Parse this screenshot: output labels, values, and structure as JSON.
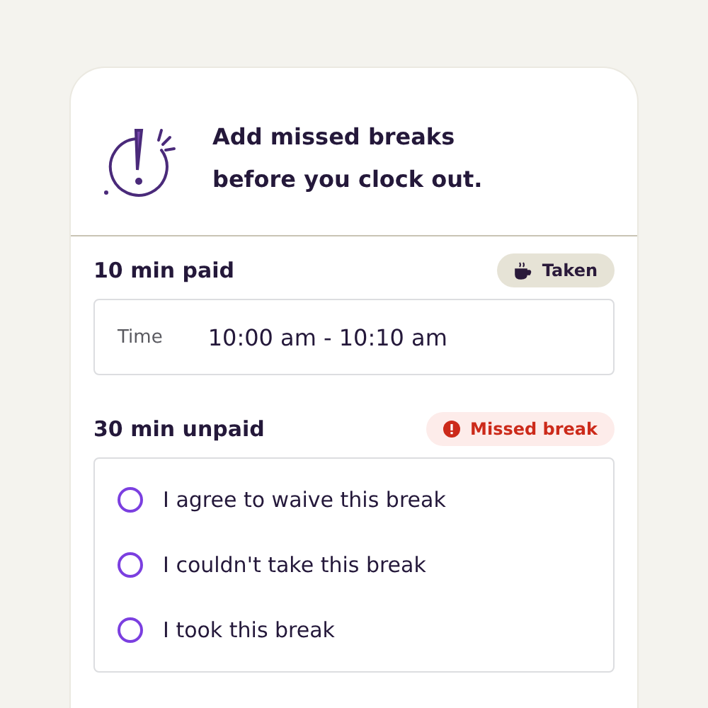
{
  "header": {
    "message": "Add missed breaks before you clock out."
  },
  "breaks": [
    {
      "title": "10 min paid",
      "status": {
        "kind": "taken",
        "label": "Taken"
      },
      "kind": "time",
      "time_label": "Time",
      "time_value": "10:00 am - 10:10 am"
    },
    {
      "title": "30 min unpaid",
      "status": {
        "kind": "missed",
        "label": "Missed break"
      },
      "kind": "options",
      "options": [
        {
          "label": "I agree to waive this break",
          "selected": false
        },
        {
          "label": "I couldn't take this break",
          "selected": false
        },
        {
          "label": "I took this break",
          "selected": false
        }
      ]
    }
  ]
}
